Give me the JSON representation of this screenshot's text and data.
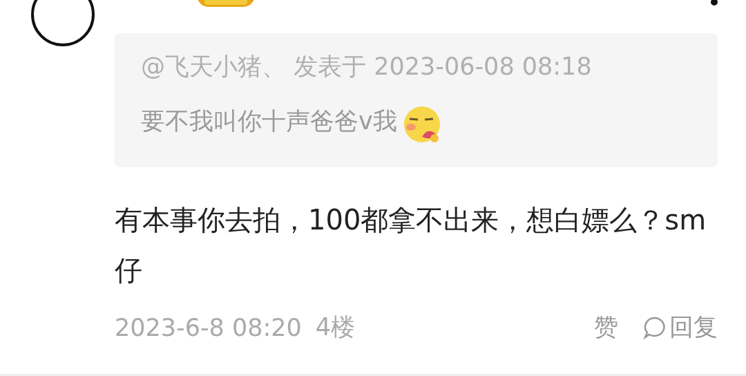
{
  "quote": {
    "author_line": "@飞天小猪、 发表于 2023-06-08 08:18",
    "text": "要不我叫你十声爸爸v我"
  },
  "body": "有本事你去拍，100都拿不出来，想白嫖么？sm仔",
  "footer": {
    "time": "2023-6-8 08:20",
    "floor": "4楼",
    "actions": [
      {
        "kind": "like",
        "label": "赞"
      },
      {
        "kind": "reply",
        "label": "回复"
      }
    ]
  }
}
